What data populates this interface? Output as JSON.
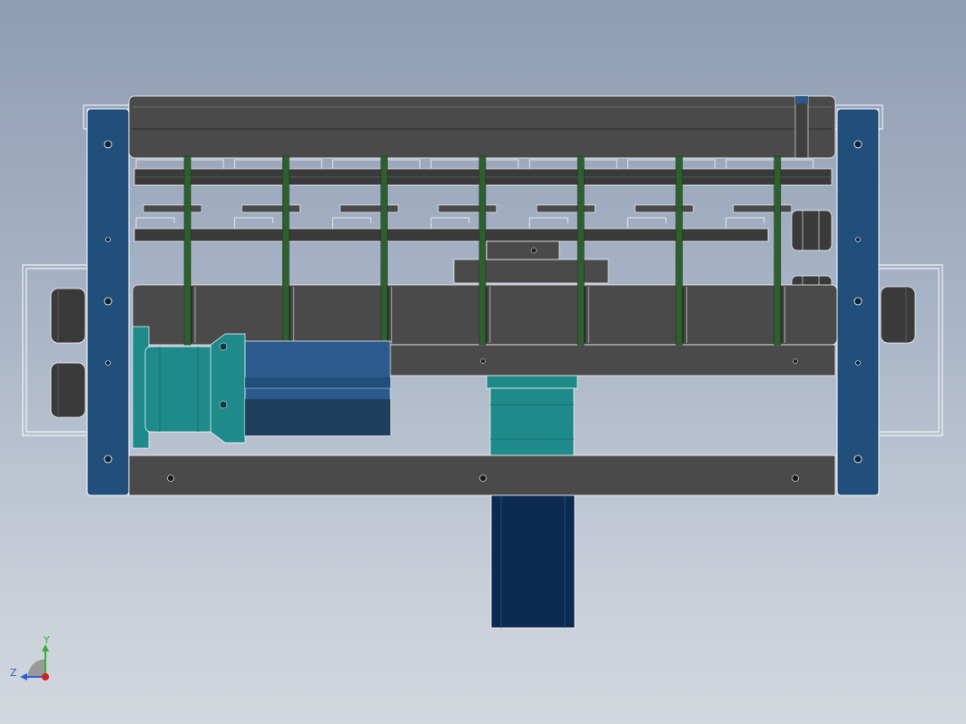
{
  "viewport": {
    "background_top": "#8f9db3",
    "background_bottom": "#d3d7de",
    "colors": {
      "frame_blue": "#1f4f7a",
      "housing_gray": "#4a4a4a",
      "dark_gray": "#3a3a3a",
      "teal": "#1f8a8a",
      "motor_blue": "#2a5b8c",
      "belt_green": "#2e5f2e",
      "outline": "#ffffff"
    }
  },
  "model": {
    "name": "3d-assembly-front-view",
    "belt_count": 7,
    "roller_count": 7
  },
  "triad": {
    "y_label": "Y",
    "z_label": "Z",
    "x_color": "#d02020",
    "y_color": "#2fb52f",
    "z_color": "#2f5fd0"
  }
}
